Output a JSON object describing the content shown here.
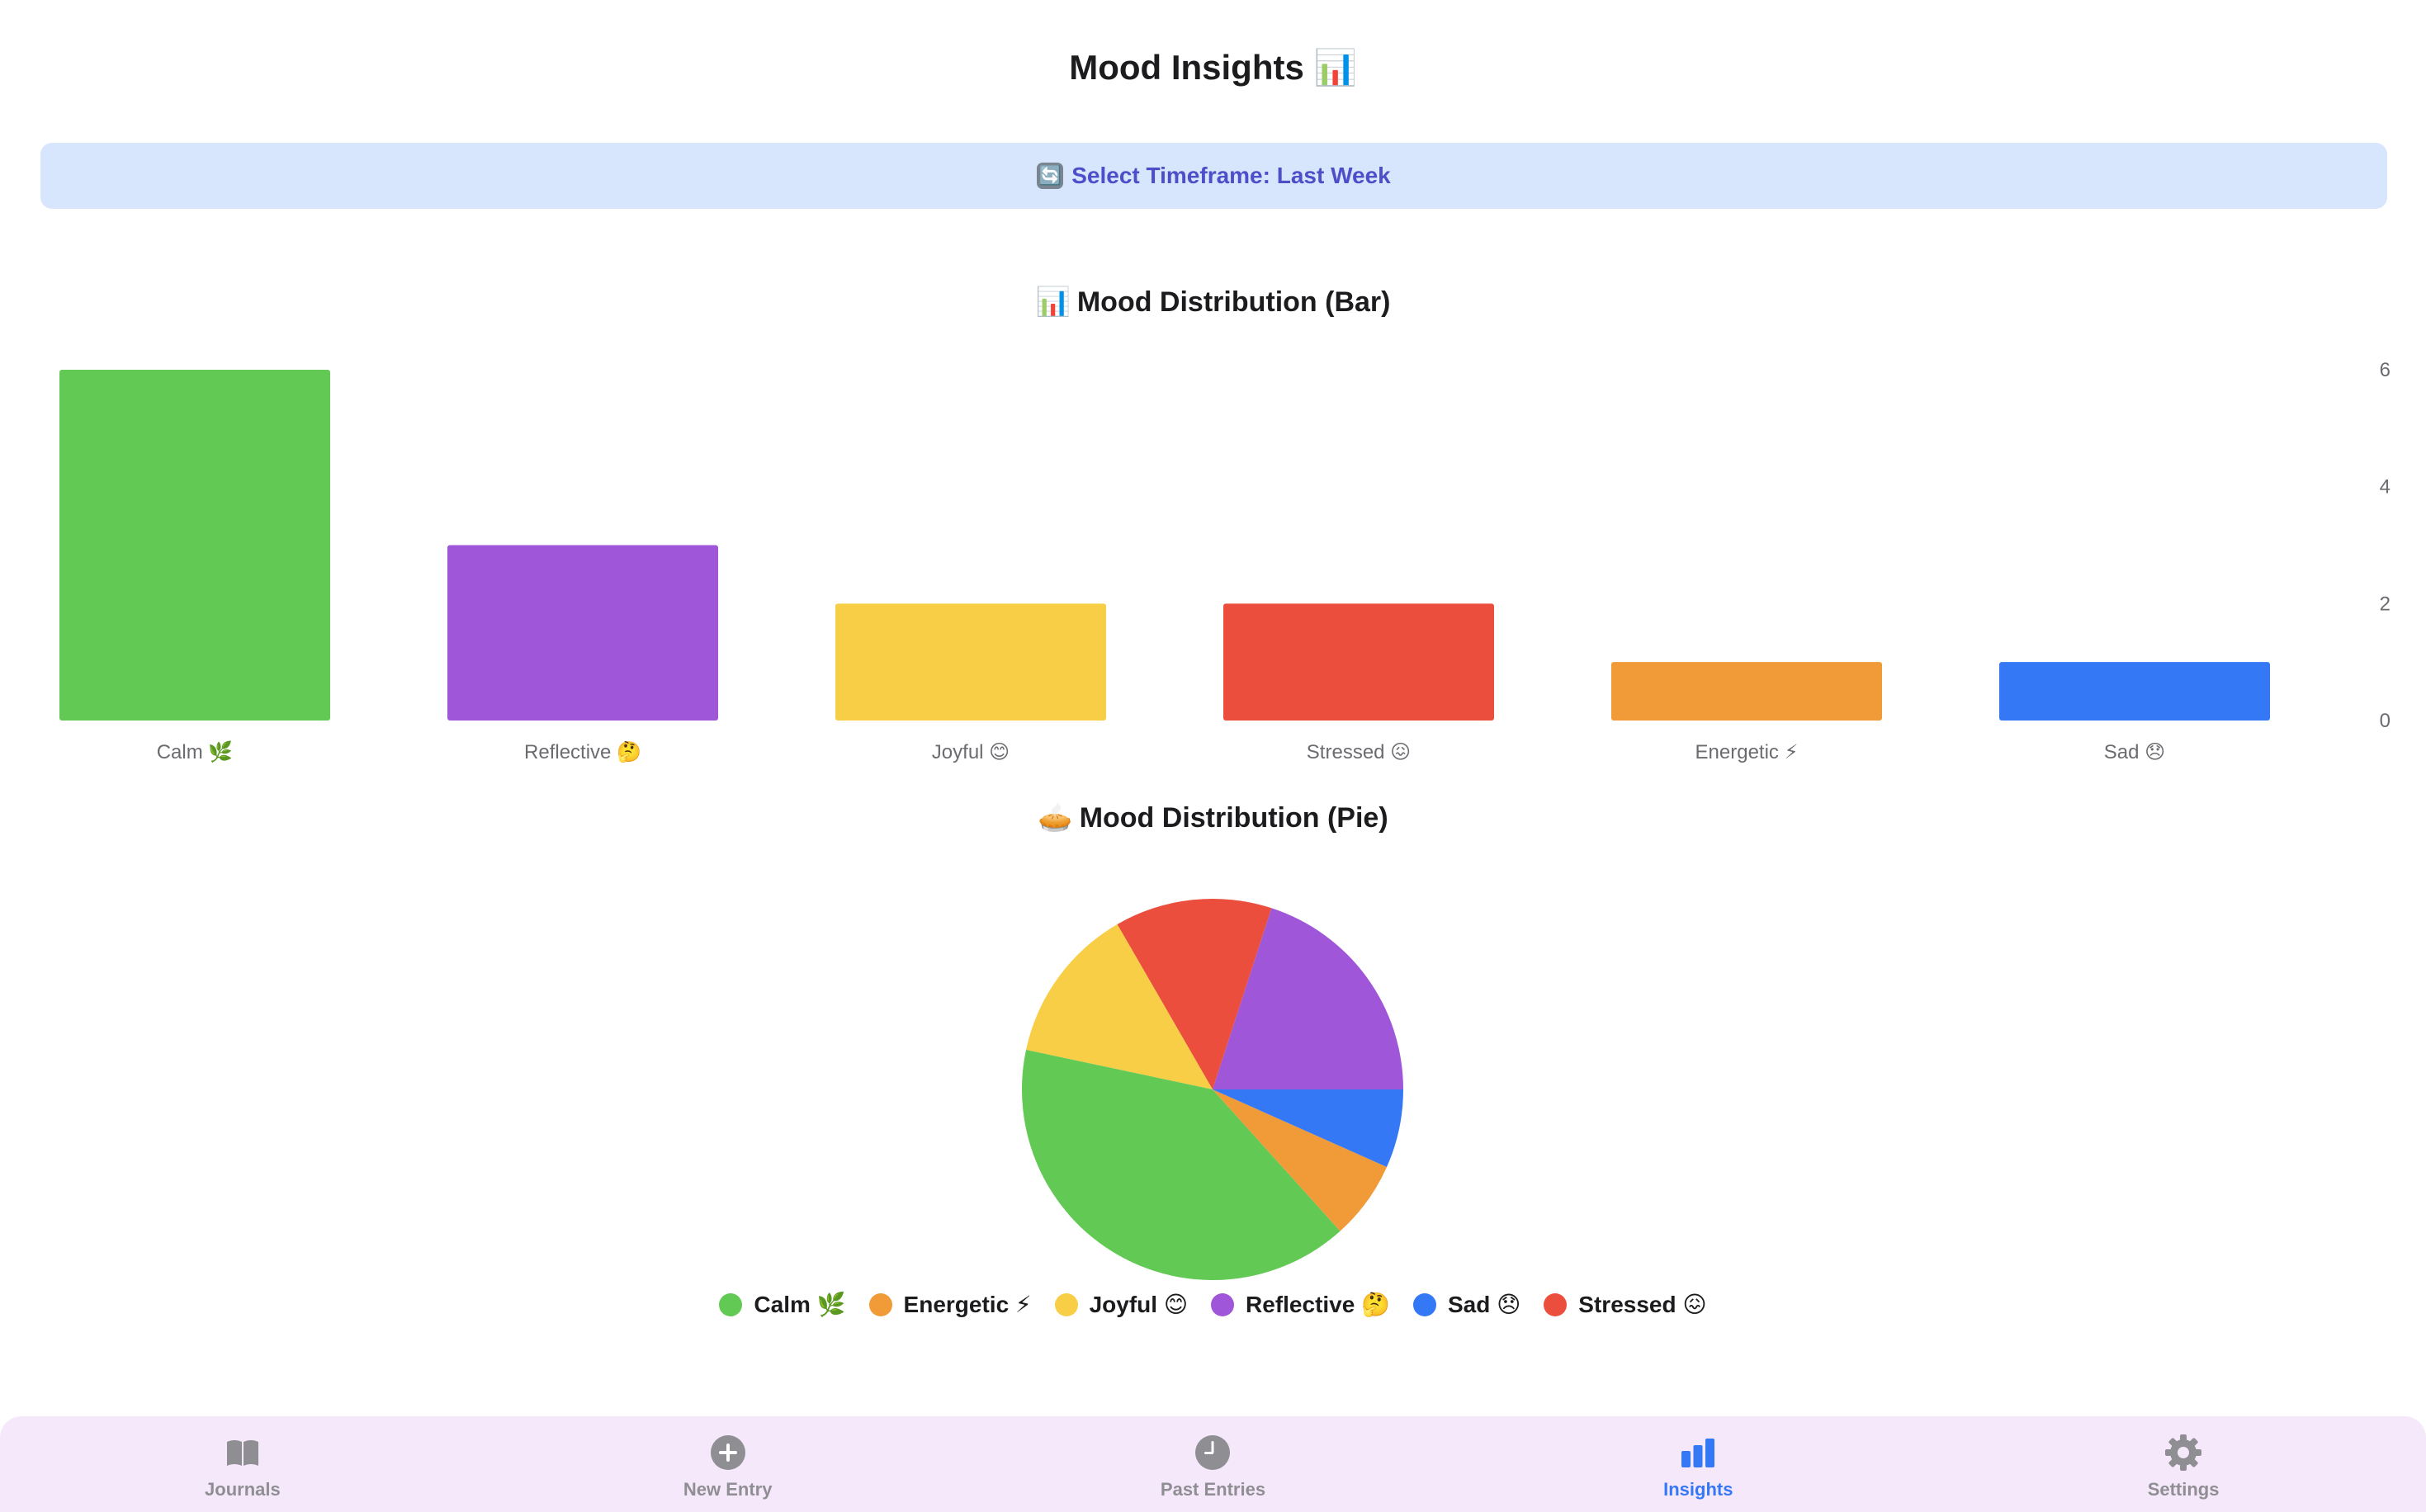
{
  "header": {
    "title": "Mood Insights 📊"
  },
  "timeframe": {
    "icon": "🔄",
    "label": "Select Timeframe: Last Week"
  },
  "bar_section": {
    "icon": "📊",
    "title": "Mood Distribution (Bar)"
  },
  "pie_section": {
    "icon": "🥧",
    "title": "Mood Distribution (Pie)"
  },
  "colors": {
    "calm": "#63c955",
    "reflective": "#a056d8",
    "joyful": "#f7ce46",
    "stressed": "#eb4e3d",
    "energetic": "#f19a38",
    "sad": "#3478f6",
    "accent": "#3478f6",
    "tab_bar_bg": "#f6e8fb",
    "timeframe_bg": "#d7e5fd"
  },
  "chart_data": [
    {
      "type": "bar",
      "title": "Mood Distribution (Bar)",
      "categories": [
        "Calm 🌿",
        "Reflective 🤔",
        "Joyful 😊",
        "Stressed 😖",
        "Energetic ⚡",
        "Sad 😞"
      ],
      "values": [
        6,
        3,
        2,
        2,
        1,
        1
      ],
      "colors": [
        "#63c955",
        "#a056d8",
        "#f7ce46",
        "#eb4e3d",
        "#f19a38",
        "#3478f6"
      ],
      "yticks": [
        0,
        2,
        4,
        6
      ],
      "ylim": [
        0,
        6
      ],
      "y_axis_position": "right",
      "grid": false
    },
    {
      "type": "pie",
      "title": "Mood Distribution (Pie)",
      "slices": [
        {
          "name": "Reflective 🤔",
          "value": 3,
          "color": "#a056d8"
        },
        {
          "name": "Stressed 😖",
          "value": 2,
          "color": "#eb4e3d"
        },
        {
          "name": "Joyful 😊",
          "value": 2,
          "color": "#f7ce46"
        },
        {
          "name": "Calm 🌿",
          "value": 6,
          "color": "#63c955"
        },
        {
          "name": "Energetic ⚡",
          "value": 1,
          "color": "#f19a38"
        },
        {
          "name": "Sad 😞",
          "value": 1,
          "color": "#3478f6"
        }
      ],
      "legend": [
        "Calm 🌿",
        "Energetic ⚡",
        "Joyful 😊",
        "Reflective 🤔",
        "Sad 😞",
        "Stressed 😖"
      ],
      "legend_colors": [
        "#63c955",
        "#f19a38",
        "#f7ce46",
        "#a056d8",
        "#3478f6",
        "#eb4e3d"
      ],
      "legend_placement": "bottom"
    }
  ],
  "tabs": [
    {
      "label": "Journals",
      "icon": "book-icon",
      "active": false
    },
    {
      "label": "New Entry",
      "icon": "plus-circle-icon",
      "active": false
    },
    {
      "label": "Past Entries",
      "icon": "clock-icon",
      "active": false
    },
    {
      "label": "Insights",
      "icon": "chart-bar-icon",
      "active": true
    },
    {
      "label": "Settings",
      "icon": "gear-icon",
      "active": false
    }
  ]
}
